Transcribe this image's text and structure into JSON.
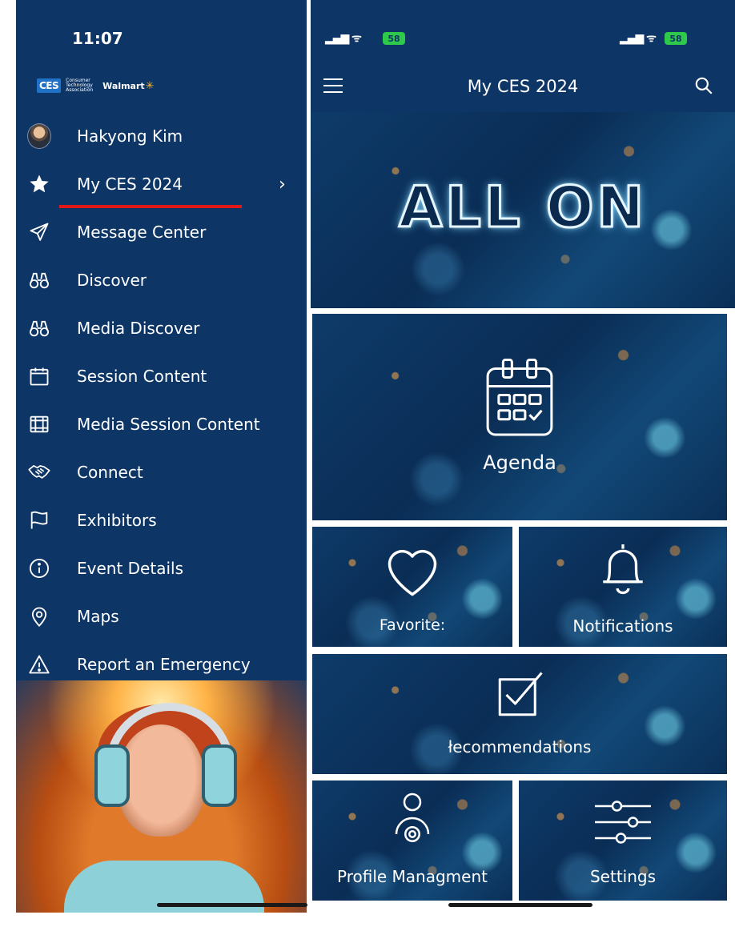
{
  "left_panel": {
    "status_time": "11:07",
    "logos": {
      "ces": "CES",
      "cta": "Consumer Technology Association",
      "walmart": "Walmart"
    },
    "menu": [
      {
        "label": "Hakyong Kim",
        "icon": "avatar"
      },
      {
        "label": "My CES 2024",
        "icon": "star-icon",
        "selected": true
      },
      {
        "label": "Message Center",
        "icon": "send-icon"
      },
      {
        "label": "Discover",
        "icon": "binoculars-icon"
      },
      {
        "label": "Media Discover",
        "icon": "binoculars-icon"
      },
      {
        "label": "Session Content",
        "icon": "calendar-icon"
      },
      {
        "label": "Media Session Content",
        "icon": "film-icon"
      },
      {
        "label": "Connect",
        "icon": "handshake-icon"
      },
      {
        "label": "Exhibitors",
        "icon": "flag-icon"
      },
      {
        "label": "Event Details",
        "icon": "info-icon"
      },
      {
        "label": "Maps",
        "icon": "location-pin-icon"
      },
      {
        "label": "Report an Emergency",
        "icon": "warning-icon"
      }
    ],
    "selected_chevron": "›",
    "highlight_color": "#e01818"
  },
  "right_panel": {
    "status": {
      "battery": "58"
    },
    "header_title": "My CES 2024",
    "banner_text": "ALL ON",
    "tiles": {
      "agenda": "Agenda",
      "favorites": "Favorite:",
      "notifications": "Notifications",
      "recommendations": "łecommendations",
      "profile": "Profile Managment",
      "settings": "Settings"
    }
  },
  "colors": {
    "brand_navy": "#0d3566",
    "battery_green": "#2ec94a"
  }
}
